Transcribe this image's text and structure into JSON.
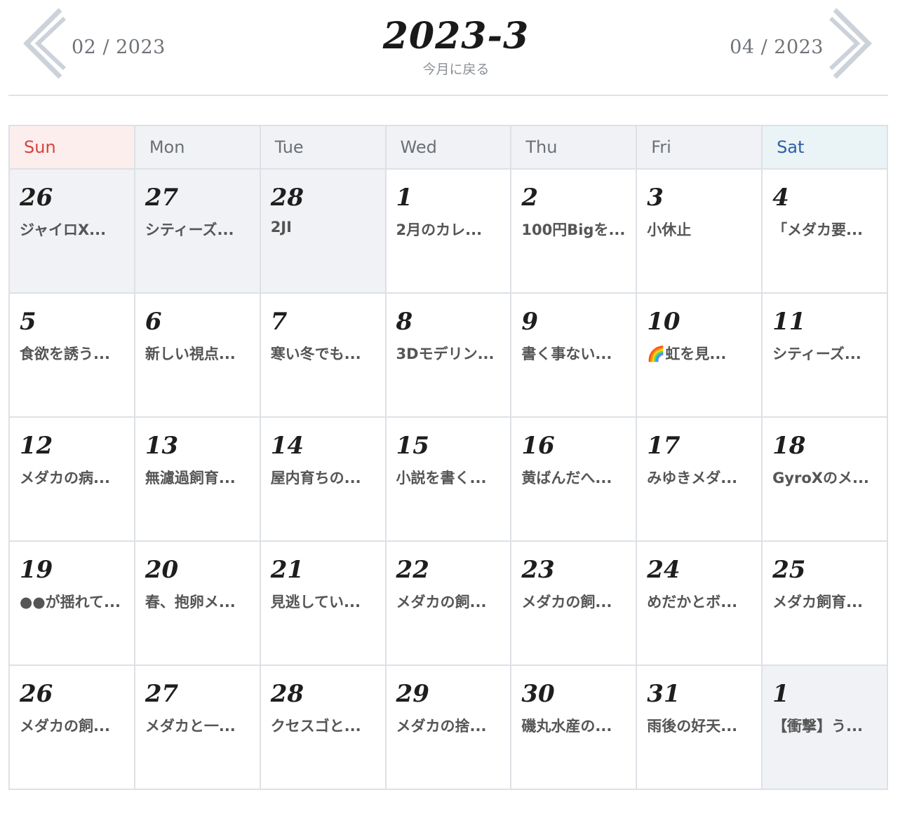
{
  "header": {
    "prev_label": "02 / 2023",
    "next_label": "04 / 2023",
    "title": "2023-3",
    "back_today": "今月に戻る"
  },
  "colors": {
    "sunday": "#d9423b",
    "saturday": "#2b5fa8",
    "chevron": "#ccd2da",
    "other_month_bg": "#f1f2f5"
  },
  "weekdays": [
    "Sun",
    "Mon",
    "Tue",
    "Wed",
    "Thu",
    "Fri",
    "Sat"
  ],
  "weeks": [
    [
      {
        "day": "26",
        "other": true,
        "post": "ジャイロX..."
      },
      {
        "day": "27",
        "other": true,
        "post": "シティーズ..."
      },
      {
        "day": "28",
        "other": true,
        "post": "2JI"
      },
      {
        "day": "1",
        "other": false,
        "post": "2月のカレ..."
      },
      {
        "day": "2",
        "other": false,
        "post": "100円Bigを..."
      },
      {
        "day": "3",
        "other": false,
        "post": "小休止"
      },
      {
        "day": "4",
        "other": false,
        "post": "「メダカ要..."
      }
    ],
    [
      {
        "day": "5",
        "other": false,
        "post": "食欲を誘う..."
      },
      {
        "day": "6",
        "other": false,
        "post": "新しい視点..."
      },
      {
        "day": "7",
        "other": false,
        "post": "寒い冬でも..."
      },
      {
        "day": "8",
        "other": false,
        "post": "3Dモデリン..."
      },
      {
        "day": "9",
        "other": false,
        "post": "書く事ない..."
      },
      {
        "day": "10",
        "other": false,
        "post": "🌈虹を見..."
      },
      {
        "day": "11",
        "other": false,
        "post": "シティーズ..."
      }
    ],
    [
      {
        "day": "12",
        "other": false,
        "post": "メダカの病..."
      },
      {
        "day": "13",
        "other": false,
        "post": "無濾過飼育..."
      },
      {
        "day": "14",
        "other": false,
        "post": "屋内育ちの..."
      },
      {
        "day": "15",
        "other": false,
        "post": "小説を書く..."
      },
      {
        "day": "16",
        "other": false,
        "post": "黄ばんだへ..."
      },
      {
        "day": "17",
        "other": false,
        "post": "みゆきメダ..."
      },
      {
        "day": "18",
        "other": false,
        "post": "GyroXのメ..."
      }
    ],
    [
      {
        "day": "19",
        "other": false,
        "post": "●●が揺れて..."
      },
      {
        "day": "20",
        "other": false,
        "post": "春、抱卵メ..."
      },
      {
        "day": "21",
        "other": false,
        "post": "見逃してい..."
      },
      {
        "day": "22",
        "other": false,
        "post": "メダカの飼..."
      },
      {
        "day": "23",
        "other": false,
        "post": "メダカの飼..."
      },
      {
        "day": "24",
        "other": false,
        "post": "めだかとボ..."
      },
      {
        "day": "25",
        "other": false,
        "post": "メダカ飼育..."
      }
    ],
    [
      {
        "day": "26",
        "other": false,
        "post": "メダカの飼..."
      },
      {
        "day": "27",
        "other": false,
        "post": "メダカと一..."
      },
      {
        "day": "28",
        "other": false,
        "post": "クセスゴと..."
      },
      {
        "day": "29",
        "other": false,
        "post": "メダカの捨..."
      },
      {
        "day": "30",
        "other": false,
        "post": "磯丸水産の..."
      },
      {
        "day": "31",
        "other": false,
        "post": "雨後の好天..."
      },
      {
        "day": "1",
        "other": true,
        "post": "【衝撃】う..."
      }
    ]
  ]
}
